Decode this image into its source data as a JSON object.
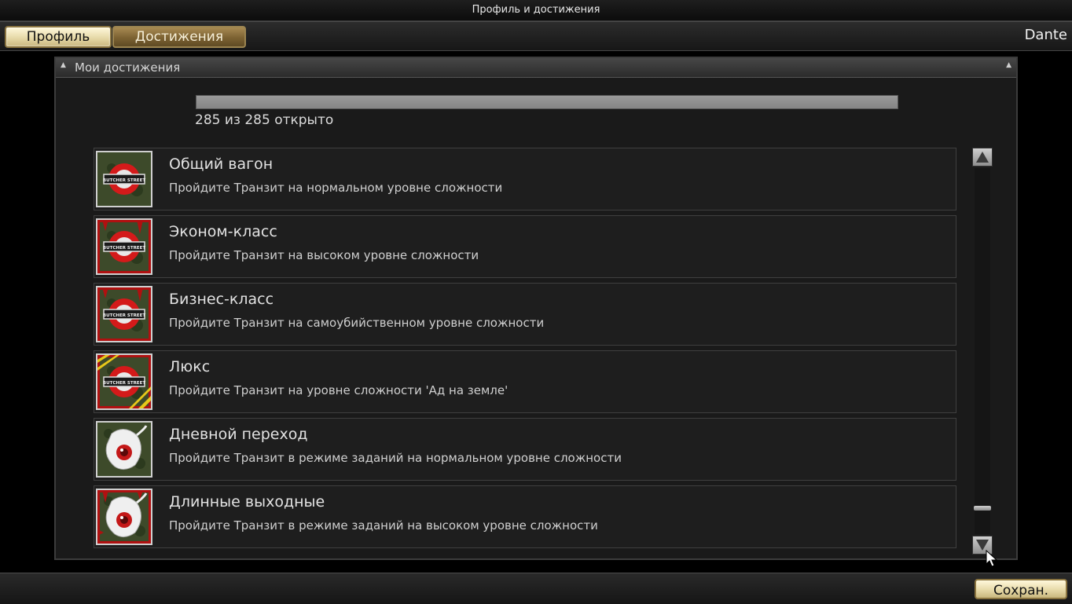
{
  "window": {
    "title": "Профиль и достижения"
  },
  "tabs": [
    {
      "label": "Профиль"
    },
    {
      "label": "Достижения"
    }
  ],
  "user": {
    "name": "Dante"
  },
  "panel": {
    "title": "Мои достижения",
    "progress": {
      "unlocked": 285,
      "total": 285,
      "fraction": 1.0,
      "text": "285 из 285 открыто"
    }
  },
  "achievements": [
    {
      "title": "Общий вагон",
      "description": "Пройдите Транзит на нормальном уровне сложности",
      "icon": "butcher-street-sign-icon",
      "frame": "none"
    },
    {
      "title": "Эконом-класс",
      "description": "Пройдите Транзит на высоком уровне сложности",
      "icon": "butcher-street-sign-icon",
      "frame": "red"
    },
    {
      "title": "Бизнес-класс",
      "description": "Пройдите Транзит на самоубийственном уровне сложности",
      "icon": "butcher-street-sign-icon",
      "frame": "red"
    },
    {
      "title": "Люкс",
      "description": "Пройдите Транзит на уровне сложности 'Ад на земле'",
      "icon": "butcher-street-sign-icon",
      "frame": "hazard"
    },
    {
      "title": "Дневной переход",
      "description": "Пройдите Транзит в режиме заданий на нормальном уровне сложности",
      "icon": "ghost-eye-icon",
      "frame": "none"
    },
    {
      "title": "Длинные выходные",
      "description": "Пройдите Транзит в режиме заданий на высоком уровне сложности",
      "icon": "ghost-eye-icon",
      "frame": "red"
    }
  ],
  "icon_text": {
    "sign": "BUTCHER STREET"
  },
  "footer": {
    "save_label": "Сохран."
  },
  "colors": {
    "accent_gold": "#e6d9a8",
    "tab_active": "#7c6232",
    "blood": "#b01010"
  }
}
